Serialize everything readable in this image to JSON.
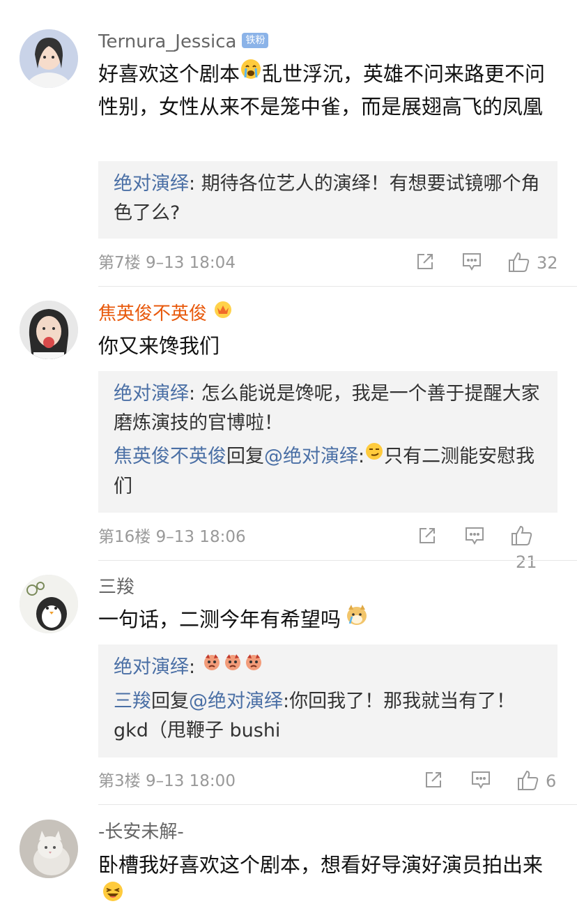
{
  "comments": [
    {
      "username": "Ternura_Jessica",
      "badge": "铁粉",
      "text_part1": "好喜欢这个剧本",
      "text_part2": "乱世浮沉，英雄不问来路更不问性别，女性从来不是笼中雀，而是展翅高飞的凤凰",
      "replies": [
        {
          "author": "绝对演绎",
          "sep": ": ",
          "content": "期待各位艺人的演绎！有想要试镜哪个角色了么?"
        }
      ],
      "floor": "第7楼",
      "time": "9–13 18:04",
      "likes": "32"
    },
    {
      "username": "焦英俊不英俊",
      "text": "你又来馋我们",
      "replies": [
        {
          "author": "绝对演绎",
          "sep": ": ",
          "content": "怎么能说是馋呢，我是一个善于提醒大家磨炼演技的官博啦！"
        },
        {
          "author": "焦英俊不英俊",
          "reply_word": "回复",
          "mention": "@绝对演绎",
          "sep": ":",
          "content": "只有二测能安慰我们"
        }
      ],
      "floor": "第16楼",
      "time": "9–13 18:06",
      "likes": "21"
    },
    {
      "username": "三羧",
      "text": "一句话，二测今年有希望吗",
      "replies": [
        {
          "author": "绝对演绎",
          "sep": ": ",
          "content": ""
        },
        {
          "author": "三羧",
          "reply_word": "回复",
          "mention": "@绝对演绎",
          "sep": ":",
          "content": "你回我了！那我就当有了！gkd（甩鞭子 bushi"
        }
      ],
      "floor": "第3楼",
      "time": "9–13 18:00",
      "likes": "6"
    },
    {
      "username": "-长安未解-",
      "text": "卧槽我好喜欢这个剧本，想看好导演好演员拍出来"
    }
  ],
  "icons": {
    "share": "share-icon",
    "comment": "comment-icon",
    "like": "like-icon"
  },
  "colors": {
    "link": "#4a6fa5",
    "vip_name": "#e8590c",
    "badge": "#8bb3e8",
    "reply_bg": "#f3f3f3"
  }
}
